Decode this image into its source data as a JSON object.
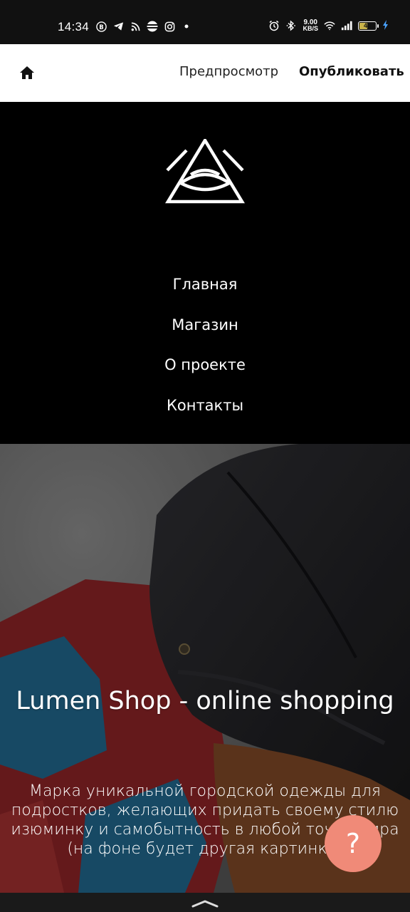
{
  "status_bar": {
    "time": "14:34",
    "left_icons": [
      "vk-icon",
      "telegram-icon",
      "rss-icon",
      "stripes-icon",
      "instagram-icon",
      "dot-icon"
    ],
    "right_icons": [
      "alarm-icon",
      "bluetooth-icon",
      "wifi-icon",
      "signal-icon"
    ],
    "speed_value": "9.00",
    "speed_unit": "KB/S",
    "battery_level": "46",
    "battery_charging": true,
    "colors": {
      "background": "#111111",
      "battery_fill": "#c9b34a",
      "charging_bolt": "#4aa3ff"
    }
  },
  "appbar": {
    "home_icon": "home-icon",
    "preview_label": "Предпросмотр",
    "publish_label": "Опубликовать"
  },
  "site": {
    "logo_icon": "eye-triangle-logo",
    "menu": [
      {
        "label": "Главная"
      },
      {
        "label": "Магазин"
      },
      {
        "label": "О проекте"
      },
      {
        "label": "Контакты"
      }
    ],
    "hero": {
      "title": "Lumen Shop - online shopping",
      "description": "Марка уникальной городской одежды для подростков, желающих придать своему стилю изюминку и самобытность в любой точке мира (на фоне будет другая картинка)"
    },
    "help_button": "?",
    "colors": {
      "help_button": "#f08a78",
      "nav_background": "#000000"
    }
  },
  "navigation_bar": {
    "handle_icon": "chevron-up-icon"
  }
}
